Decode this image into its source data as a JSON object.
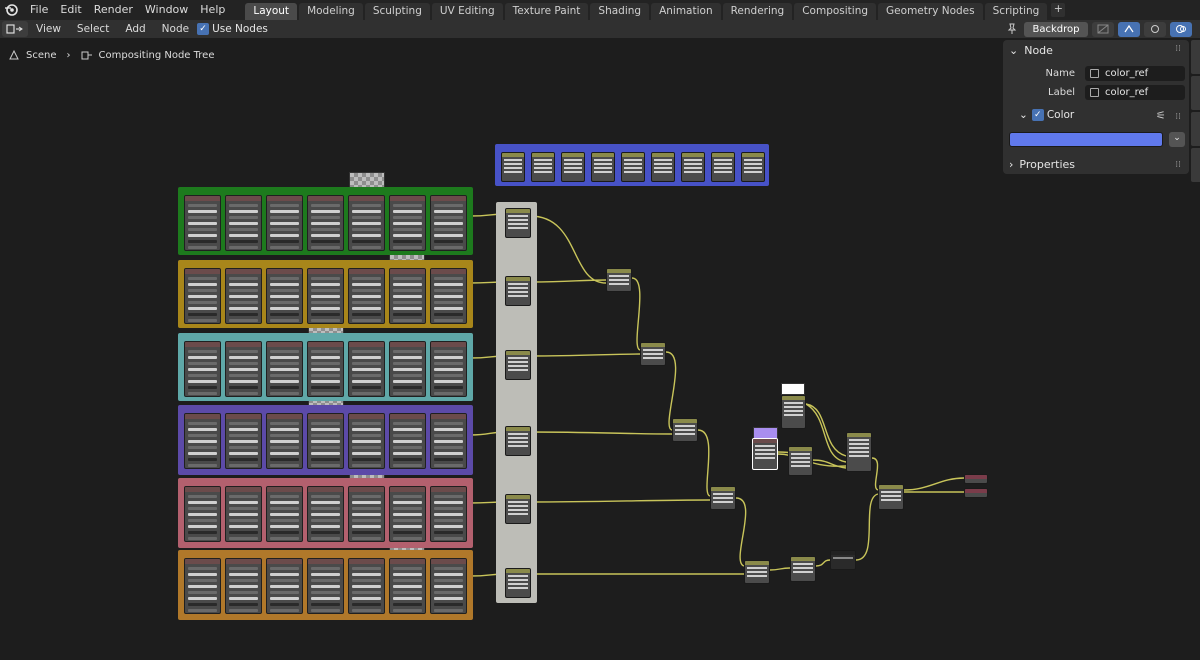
{
  "menu": {
    "items": [
      "File",
      "Edit",
      "Render",
      "Window",
      "Help"
    ],
    "workspaces": [
      "Layout",
      "Modeling",
      "Sculpting",
      "UV Editing",
      "Texture Paint",
      "Shading",
      "Animation",
      "Rendering",
      "Compositing",
      "Geometry Nodes",
      "Scripting"
    ],
    "active_workspace": "Layout",
    "add_label": "+"
  },
  "header": {
    "view": "View",
    "select": "Select",
    "add": "Add",
    "node": "Node",
    "use_nodes": "Use Nodes",
    "backdrop": "Backdrop"
  },
  "breadcrumb": {
    "scene": "Scene",
    "tree": "Compositing Node Tree"
  },
  "npanel": {
    "node_section": "Node",
    "name_label": "Name",
    "name_value": "color_ref",
    "label_label": "Label",
    "label_value": "color_ref",
    "color_label": "Color",
    "color_value": "#6079ec",
    "properties_section": "Properties"
  },
  "colors": {
    "frame_green": "#1d7a1d",
    "frame_yellow": "#a8861a",
    "frame_cyan": "#5fa8a8",
    "frame_purple": "#5c4aa8",
    "frame_pink": "#b3606e",
    "frame_orange": "#b0782a",
    "frame_blue": "#4752c7",
    "reroute_strip": "#bdbdb7",
    "wire": "#c8c45a"
  }
}
